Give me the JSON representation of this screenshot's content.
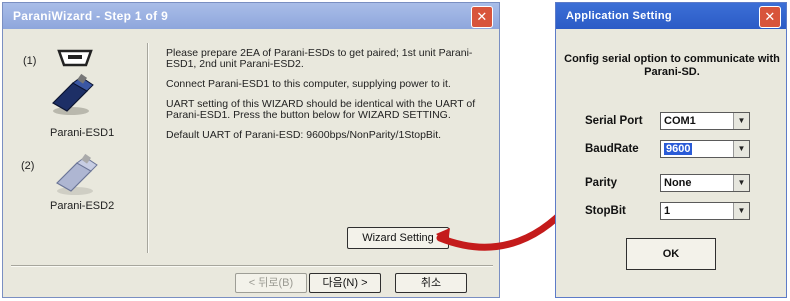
{
  "wizard": {
    "title": "ParaniWizard - Step 1 of 9",
    "close_glyph": "✕",
    "devices": [
      {
        "num": "(1)",
        "label": "Parani-ESD1"
      },
      {
        "num": "(2)",
        "label": "Parani-ESD2"
      }
    ],
    "paragraphs": [
      "Please prepare 2EA of Parani-ESDs to get paired; 1st unit Parani-ESD1, 2nd unit Parani-ESD2.",
      "Connect Parani-ESD1 to this computer, supplying power to it.",
      "UART setting of this WIZARD should be identical with the UART of Parani-ESD1. Press the button below for WIZARD SETTING.",
      "Default UART of Parani-ESD: 9600bps/NonParity/1StopBit."
    ],
    "wizard_setting_button": "Wizard Setting",
    "back_button": "< 뒤로(B)",
    "next_button": "다음(N) >",
    "cancel_button": "취소"
  },
  "app_setting": {
    "title": "Application Setting",
    "close_glyph": "✕",
    "intro": "Config serial option to communicate with Parani-SD.",
    "fields": [
      {
        "label": "Serial Port",
        "value": "COM1"
      },
      {
        "label": "BaudRate",
        "value": "9600"
      },
      {
        "label": "Parity",
        "value": "None"
      },
      {
        "label": "StopBit",
        "value": "1"
      }
    ],
    "ok_button": "OK"
  },
  "colors": {
    "arrow": "#c41b1b",
    "wizard_title_bg": "#a9bde8",
    "app_title_bg": "#2b5bc6",
    "selection": "#2a5bd7"
  }
}
